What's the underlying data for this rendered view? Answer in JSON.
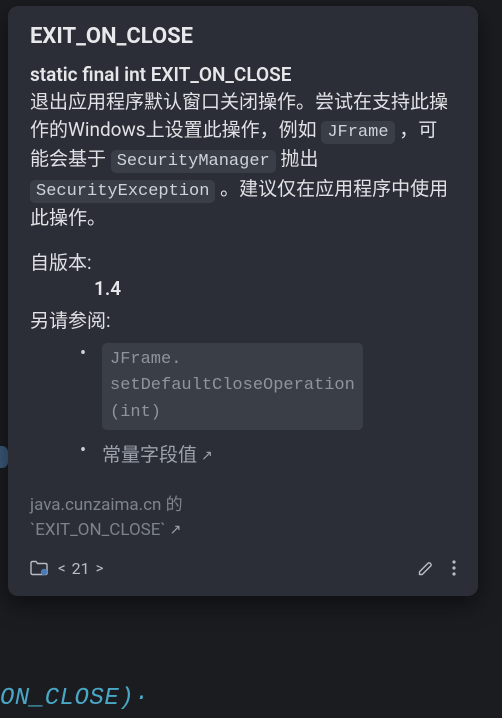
{
  "title": "EXIT_ON_CLOSE",
  "signature": "static final int EXIT_ON_CLOSE",
  "desc_part1": "退出应用程序默认窗口关闭操作。尝试在支持此操作的Windows上设置此操作，例如 ",
  "code1": "JFrame",
  "desc_part2": " ，可能会基于 ",
  "code2": "SecurityManager",
  "desc_part3": " 抛出 ",
  "code3": "SecurityException",
  "desc_part4": " 。建议仅在应用程序中使用此操作。",
  "since_label": "自版本:",
  "since_value": "1.4",
  "see_also_label": "另请参阅:",
  "see_also": [
    {
      "type": "code",
      "text": "JFrame.setDefaultCloseOperation(int)"
    },
    {
      "type": "link",
      "text": "常量字段值"
    }
  ],
  "source_prefix": "java.cunzaima.cn 的",
  "source_item": "`EXIT_ON_CLOSE`",
  "nav": {
    "prev": "<",
    "count": "21",
    "next": ">"
  },
  "bg_code": "ON_CLOSE)·"
}
